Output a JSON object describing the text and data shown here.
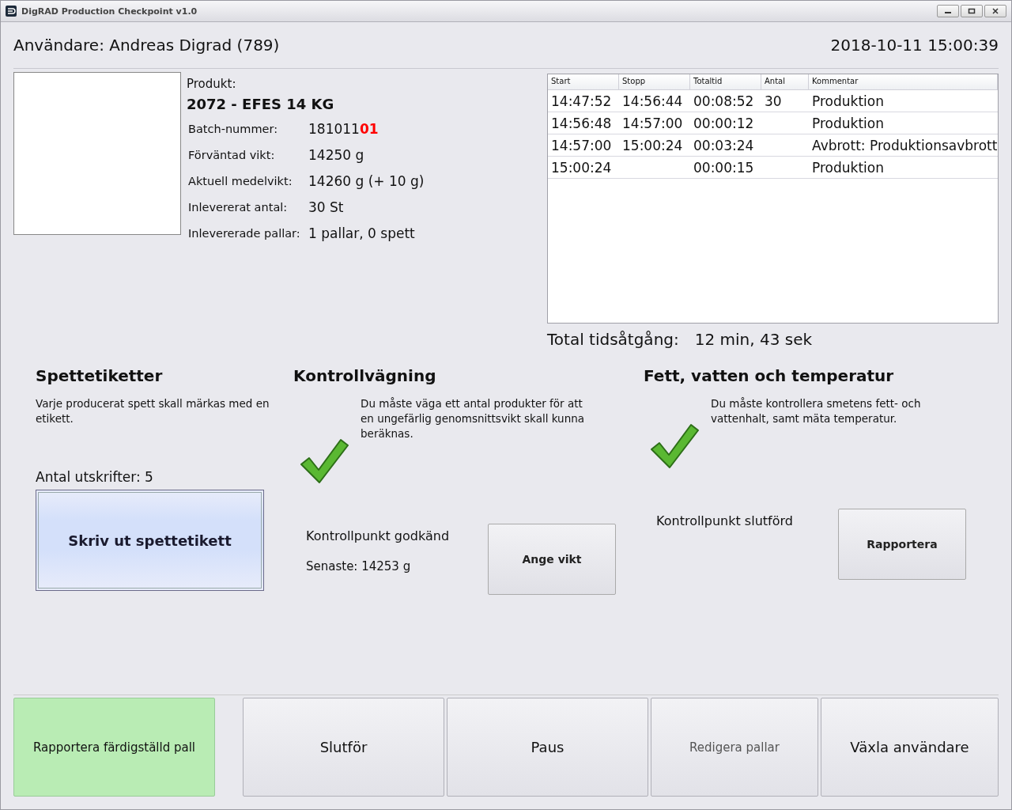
{
  "window": {
    "title": "DigRAD Production Checkpoint v1.0"
  },
  "header": {
    "user": "Användare: Andreas Digrad (789)",
    "datetime": "2018-10-11 15:00:39"
  },
  "product": {
    "label": "Produkt:",
    "name": "2072 - EFES 14 KG",
    "fields": [
      {
        "label": "Batch-nummer:",
        "value": "181011**01**"
      },
      {
        "label": "Förväntad vikt:",
        "value": "14250 g"
      },
      {
        "label": "Aktuell medelvikt:",
        "value": "14260 g (+ 10 g)"
      },
      {
        "label": "Inlevererat antal:",
        "value": "30 St"
      },
      {
        "label": "Inlevererade pallar:",
        "value": "1 pallar, 0 spett"
      }
    ]
  },
  "table": {
    "columns": [
      "Start",
      "Stopp",
      "Totaltid",
      "Antal",
      "Kommentar"
    ],
    "rows": [
      [
        "14:47:52",
        "14:56:44",
        "00:08:52",
        "30",
        "Produktion"
      ],
      [
        "14:56:48",
        "14:57:00",
        "00:00:12",
        "",
        "Produktion"
      ],
      [
        "14:57:00",
        "15:00:24",
        "00:03:24",
        "",
        "Avbrott: Produktionsavbrott"
      ],
      [
        "15:00:24",
        "",
        "00:00:15",
        "",
        "Produktion"
      ]
    ]
  },
  "total": {
    "label": "Total tidsåtgång:",
    "value": "12 min, 43 sek"
  },
  "checkpoints": [
    {
      "kind": "print",
      "title": "Spettetiketter",
      "description": "Varje producerat spett skall märkas med en etikett.",
      "count": "Antal utskrifter: 5",
      "button": "Skriv ut spettetikett"
    },
    {
      "kind": "check",
      "title": "Kontrollvägning",
      "description": "Du måste väga ett antal produkter för att en ungefärlig genomsnittsvikt skall kunna beräknas.",
      "done": true,
      "status": "Kontrollpunkt godkänd",
      "latest": "Senaste: 14253 g",
      "button": "Ange vikt"
    },
    {
      "kind": "check",
      "title": "Fett, vatten och temperatur",
      "description": "Du måste kontrollera smetens fett- och vattenhalt, samt mäta temperatur.",
      "done": true,
      "status": "Kontrollpunkt slutförd",
      "button": "Rapportera"
    }
  ],
  "actions": [
    {
      "label": "Rapportera färdigställd pall",
      "kind": "highlight",
      "disabled": false
    },
    {
      "label": "Slutför",
      "kind": "normal",
      "disabled": false
    },
    {
      "label": "Paus",
      "kind": "normal",
      "disabled": false
    },
    {
      "label": "Redigera pallar",
      "kind": "normal",
      "disabled": true
    },
    {
      "label": "Växla användare",
      "kind": "normal",
      "disabled": false
    }
  ]
}
